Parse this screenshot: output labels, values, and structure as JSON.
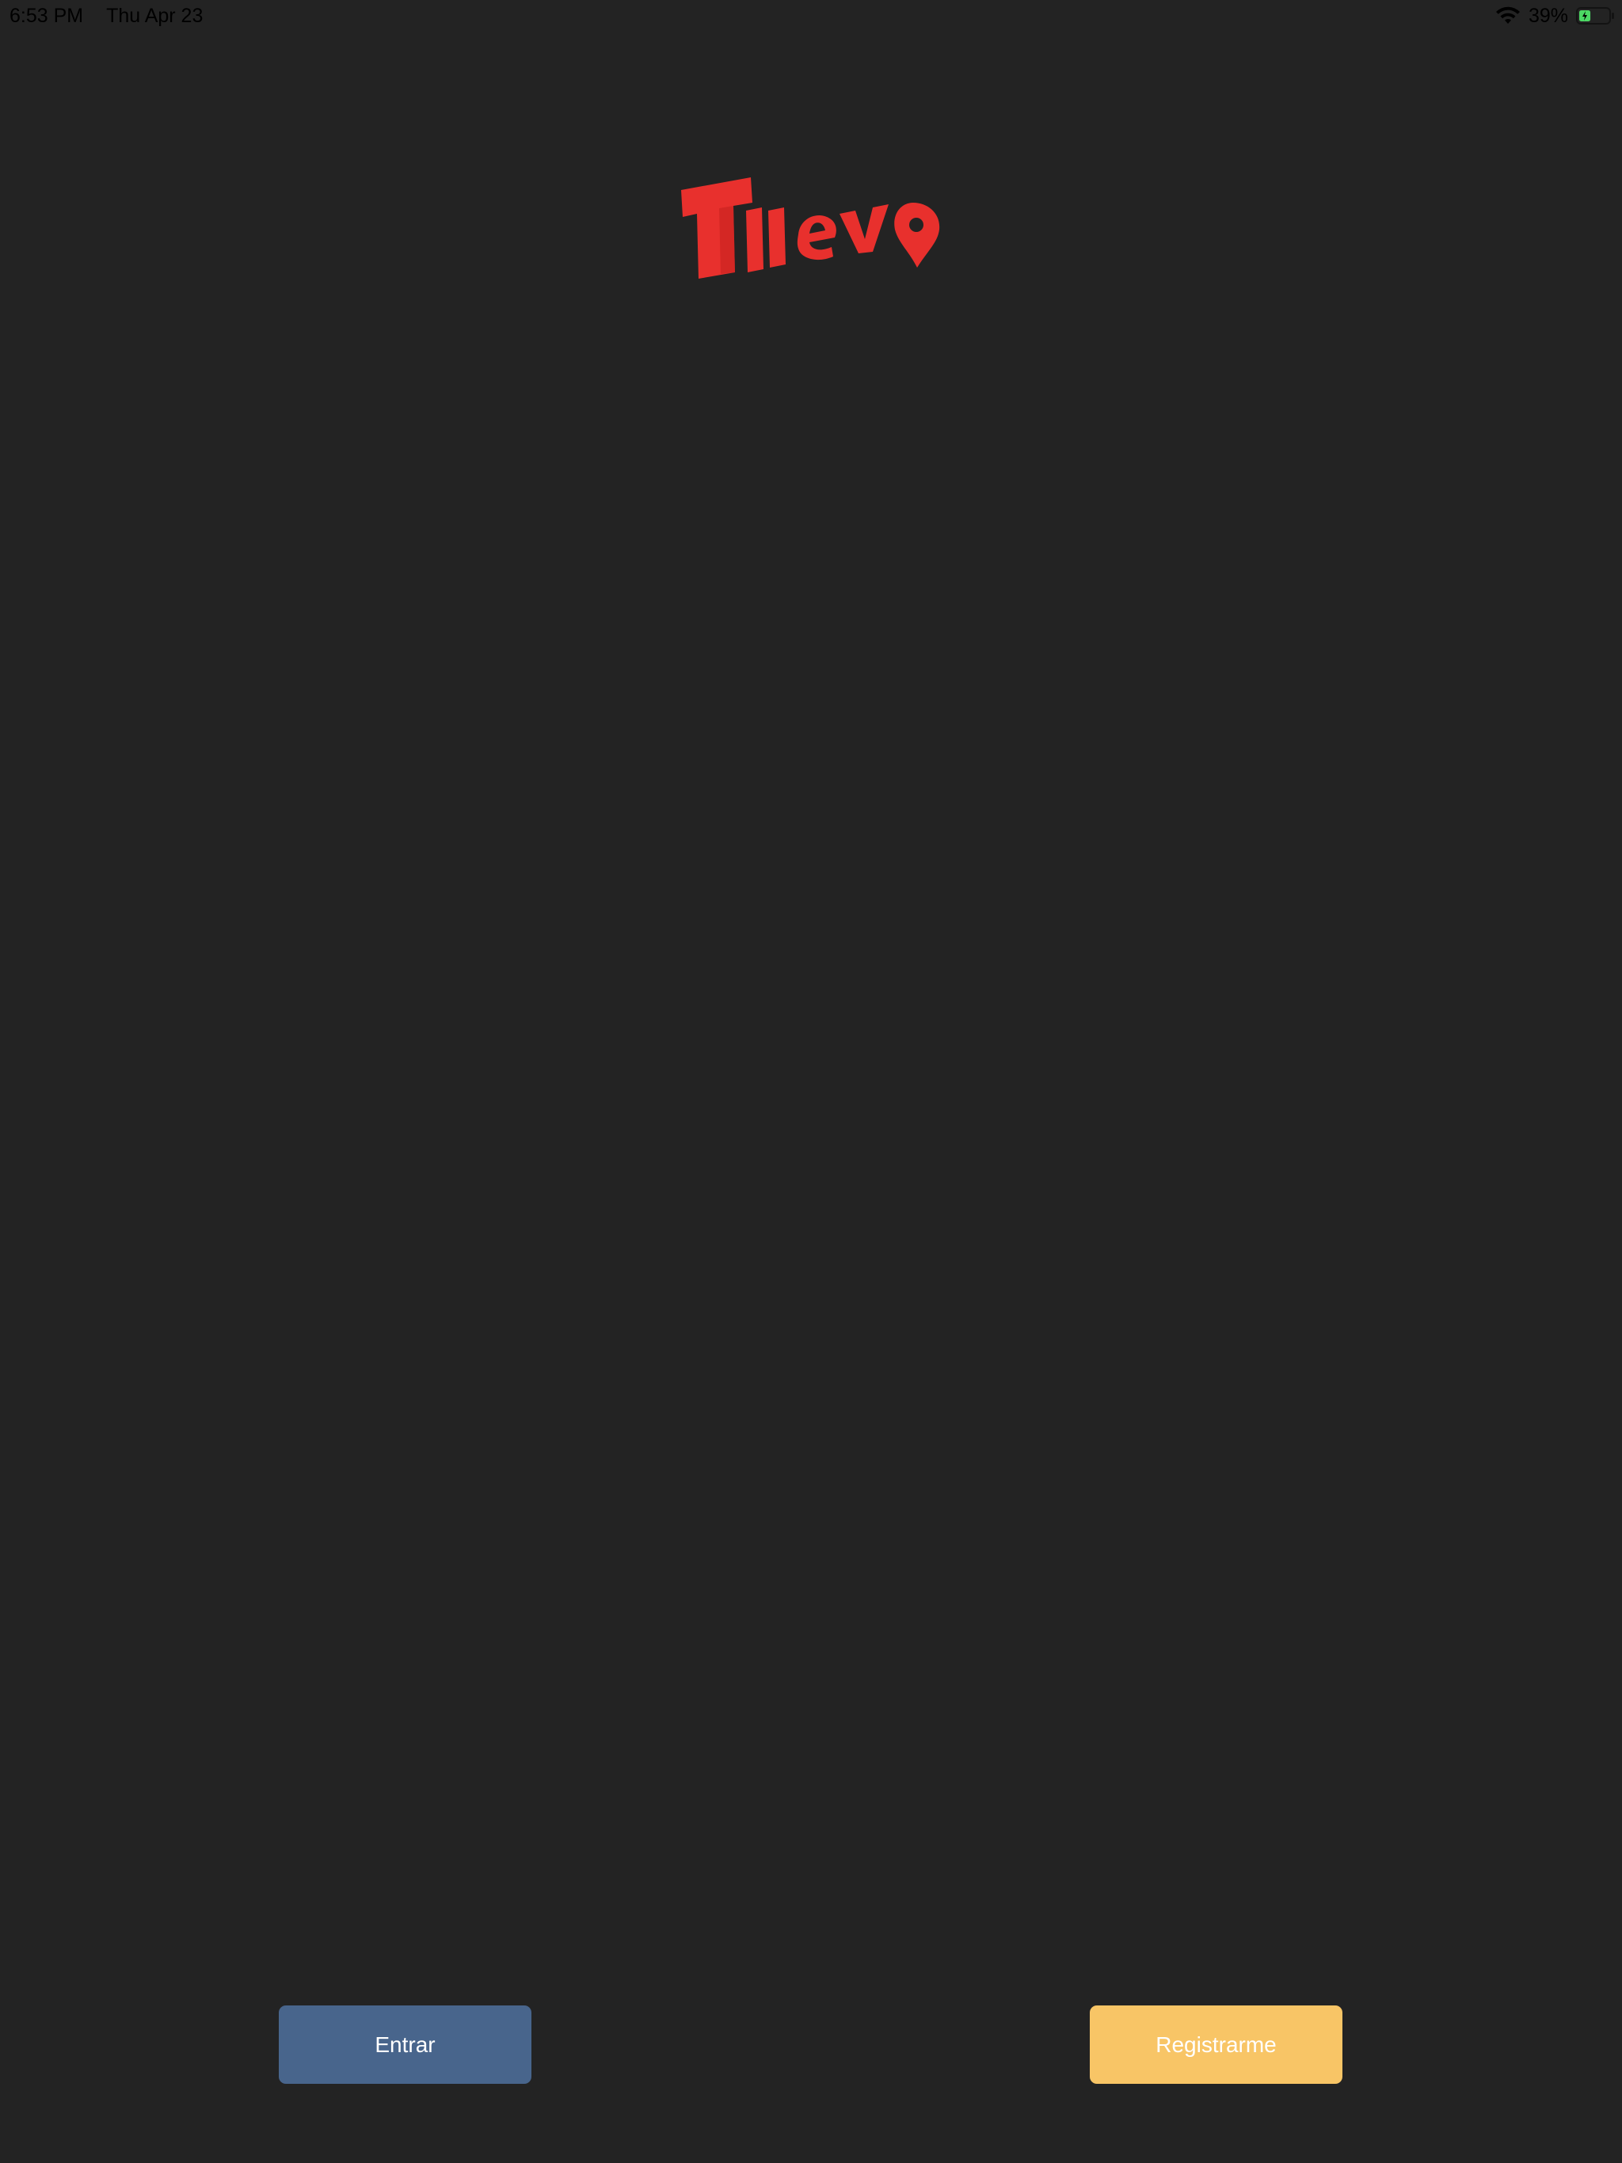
{
  "status_bar": {
    "time": "6:53 PM",
    "date": "Thu Apr 23",
    "battery_percent": "39%",
    "battery_level": 0.39,
    "battery_color": "#4cd964"
  },
  "logo": {
    "brand_text": "Tllevo",
    "color": "#e8302d"
  },
  "buttons": {
    "login_label": "Entrar",
    "login_color": "#48658c",
    "register_label": "Registrarme",
    "register_color": "#f8c566"
  },
  "background_color": "#232323"
}
